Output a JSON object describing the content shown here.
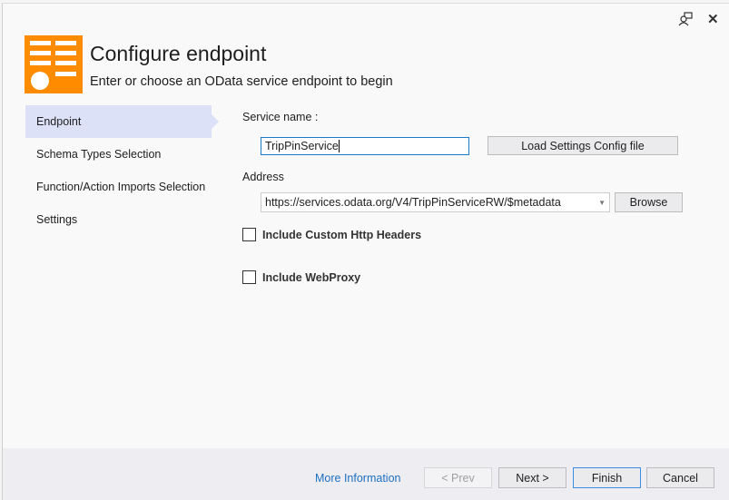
{
  "window": {
    "title_buttons": {
      "feedback_icon": "feedback-person-icon",
      "close_icon": "close-icon"
    }
  },
  "header": {
    "title": "Configure endpoint",
    "subtitle": "Enter or choose an OData service endpoint to begin",
    "logo_color": "#ff8c00"
  },
  "sidebar": {
    "items": [
      {
        "label": "Endpoint",
        "active": true
      },
      {
        "label": "Schema Types Selection",
        "active": false
      },
      {
        "label": "Function/Action Imports Selection",
        "active": false
      },
      {
        "label": "Settings",
        "active": false
      }
    ]
  },
  "form": {
    "service_name_label": "Service name :",
    "service_name_value": "TripPinService",
    "load_settings_button": "Load Settings Config file",
    "address_label": "Address",
    "address_value": "https://services.odata.org/V4/TripPinServiceRW/$metadata",
    "browse_button": "Browse",
    "include_custom_headers": {
      "label": "Include Custom Http Headers",
      "checked": false
    },
    "include_webproxy": {
      "label": "Include WebProxy",
      "checked": false
    }
  },
  "footer": {
    "more_info": "More Information",
    "prev": "< Prev",
    "next": "Next >",
    "finish": "Finish",
    "cancel": "Cancel",
    "link_color": "#1e6fc0"
  }
}
